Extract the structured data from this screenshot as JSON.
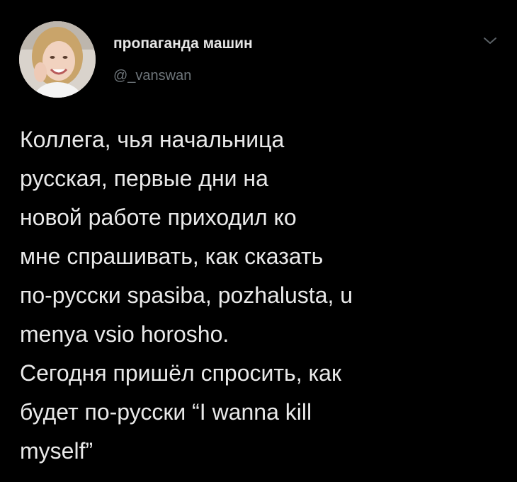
{
  "tweet": {
    "author": {
      "display_name": "пропаганда машин",
      "handle": "@_vanswan",
      "avatar_icon": "avatar-photo"
    },
    "menu_icon": "chevron-down-icon",
    "text_lines": [
      "Коллега, чья начальница",
      "русская, первые дни на",
      "новой работе приходил ко",
      "мне спрашивать, как сказать",
      "по-русски spasiba, pozhalusta, u",
      "menya vsio horosho.",
      "Сегодня пришёл спросить, как",
      "будет по-русски “I wanna kill",
      "myself”"
    ]
  },
  "colors": {
    "background": "#000000",
    "text": "#e9e9e9",
    "handle": "#6f767b"
  }
}
